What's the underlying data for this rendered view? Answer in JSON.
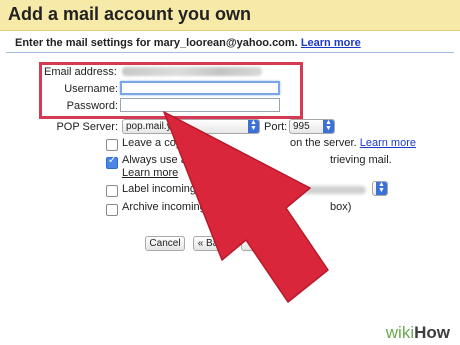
{
  "header": {
    "title": "Add a mail account you own"
  },
  "instructions": {
    "text": "Enter the mail settings for mary_loorean@yahoo.com.",
    "link": "Learn more"
  },
  "form": {
    "email_label": "Email address:",
    "username_label": "Username:",
    "password_label": "Password:",
    "username_value": "",
    "password_value": "",
    "pop_server_label": "POP Server:",
    "pop_server_value": "pop.mail.y",
    "port_label": "Port:",
    "port_value": "995"
  },
  "options": [
    {
      "text_before": "Leave a cop",
      "text_after": "on the server.",
      "link": "Learn more",
      "checked": false
    },
    {
      "text_before": "Always use a",
      "text_after": "trieving mail.",
      "link": "Learn more",
      "checked": true
    },
    {
      "text_before": "Label incoming m",
      "checked": false
    },
    {
      "text_before": "Archive incoming m",
      "text_after": "box)",
      "checked": false
    }
  ],
  "buttons": {
    "cancel": "Cancel",
    "back": "« Back",
    "add": "Accou"
  },
  "watermark": {
    "wiki": "wiki",
    "how": "How"
  },
  "colors": {
    "highlight": "#d43b52",
    "arrow": "#d9263a",
    "title_bg": "#f7e9a8",
    "link": "#1b39c9"
  }
}
